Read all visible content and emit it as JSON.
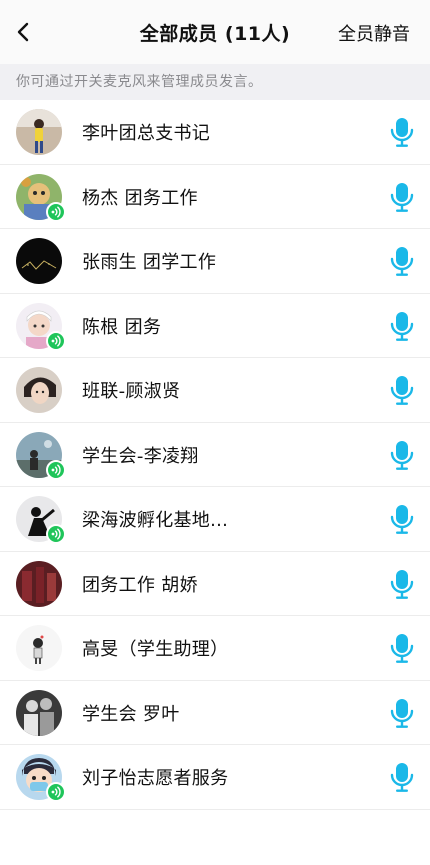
{
  "header": {
    "title": "全部成员 (11人)",
    "mute_all_label": "全员静音"
  },
  "hint": "你可通过开关麦克风来管理成员发言。",
  "colors": {
    "accent_mic": "#1ab8e8",
    "speaking_badge": "#1fc55a"
  },
  "members": [
    {
      "name": "李叶团总支书记",
      "speaking": false,
      "mic_icon": "mic-icon"
    },
    {
      "name": "杨杰 团务工作",
      "speaking": true,
      "mic_icon": "mic-icon"
    },
    {
      "name": "张雨生 团学工作",
      "speaking": false,
      "mic_icon": "mic-icon"
    },
    {
      "name": "陈根 团务",
      "speaking": true,
      "mic_icon": "mic-icon"
    },
    {
      "name": "班联-顾淑贤",
      "speaking": false,
      "mic_icon": "mic-icon"
    },
    {
      "name": "学生会-李凌翔",
      "speaking": true,
      "mic_icon": "mic-icon"
    },
    {
      "name": "梁海波孵化基地...",
      "speaking": true,
      "mic_icon": "mic-icon"
    },
    {
      "name": "团务工作 胡娇",
      "speaking": false,
      "mic_icon": "mic-icon"
    },
    {
      "name": "高旻（学生助理）",
      "speaking": false,
      "mic_icon": "mic-icon"
    },
    {
      "name": "学生会 罗叶",
      "speaking": false,
      "mic_icon": "mic-icon"
    },
    {
      "name": "刘子怡志愿者服务",
      "speaking": true,
      "mic_icon": "mic-icon"
    }
  ]
}
